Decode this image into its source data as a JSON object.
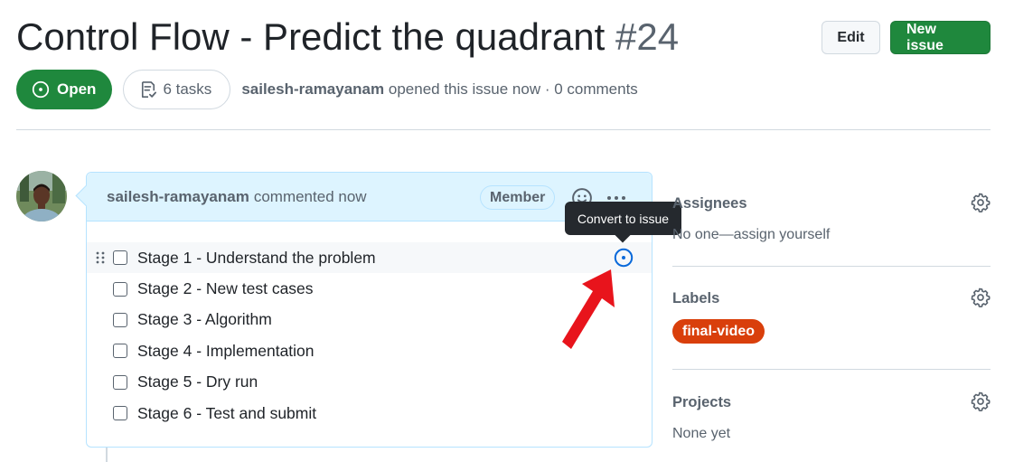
{
  "issue": {
    "title": "Control Flow - Predict the quadrant",
    "number": "#24",
    "state": "Open",
    "tasks": "6 tasks",
    "author": "sailesh-ramayanam",
    "meta": "opened this issue now · 0 comments"
  },
  "header_actions": {
    "edit_label": "Edit",
    "new_issue_label": "New issue"
  },
  "comment": {
    "author": "sailesh-ramayanam",
    "action": "commented now",
    "role_badge": "Member",
    "tasks": [
      {
        "label": "Stage 1 - Understand the problem",
        "checked": false
      },
      {
        "label": "Stage 2 - New test cases",
        "checked": false
      },
      {
        "label": "Stage 3 - Algorithm",
        "checked": false
      },
      {
        "label": "Stage 4 - Implementation",
        "checked": false
      },
      {
        "label": "Stage 5 - Dry run",
        "checked": false
      },
      {
        "label": "Stage 6 - Test and submit",
        "checked": false
      }
    ]
  },
  "tooltip": {
    "text": "Convert to issue"
  },
  "sidebar": {
    "assignees": {
      "heading": "Assignees",
      "value": "No one—assign yourself"
    },
    "labels": {
      "heading": "Labels",
      "items": [
        {
          "name": "final-video",
          "color": "#d93f0b"
        }
      ]
    },
    "projects": {
      "heading": "Projects",
      "value": "None yet"
    }
  },
  "colors": {
    "open_green": "#1f883d",
    "comment_header_bg": "#ddf4ff",
    "comment_border": "#b6e3ff",
    "label_color": "#d93f0b",
    "annotation_red": "#e8141c",
    "convert_icon_blue": "#0969da"
  }
}
